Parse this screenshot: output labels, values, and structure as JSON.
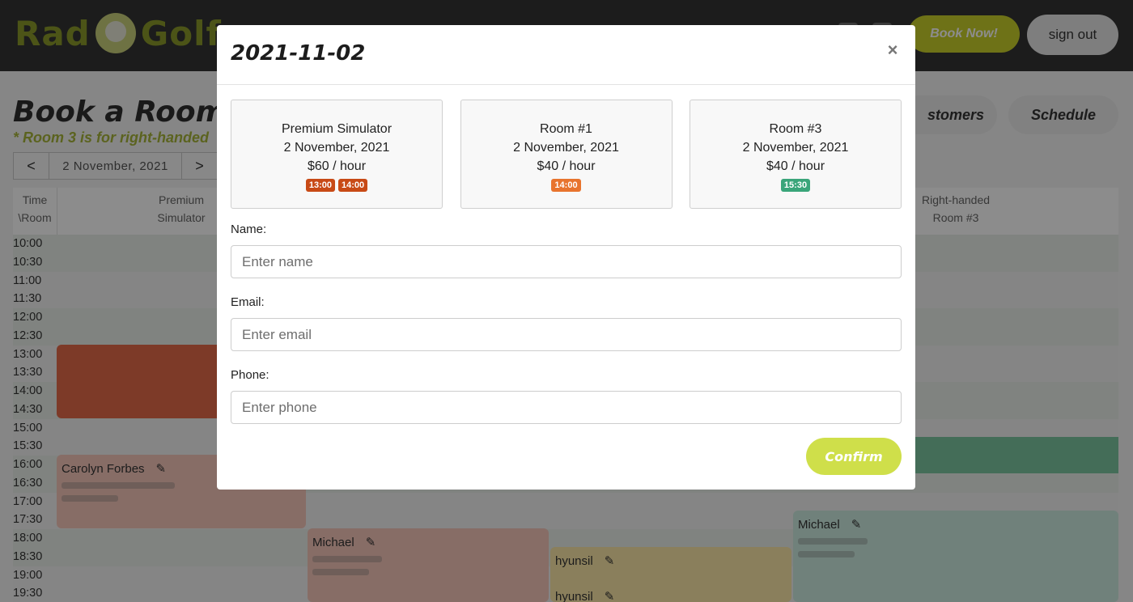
{
  "header": {
    "logo_text_left": "Rad",
    "logo_text_right": "Golf",
    "book_now": "Book Now!",
    "sign_out": "sign out"
  },
  "page": {
    "title": "Book a Room",
    "note": "* Room 3 is for right-handed",
    "date_prev": "<",
    "date": "2 November, 2021",
    "date_next": ">",
    "tab_customers": "stomers",
    "tab_schedule": "Schedule"
  },
  "grid": {
    "time_header": [
      "Time",
      "\\Room"
    ],
    "columns": [
      {
        "line1": "Premium",
        "line2": "Simulator"
      },
      {
        "line1": "Right-handed",
        "line2": "Room #3"
      }
    ],
    "times": [
      "10:00",
      "10:30",
      "11:00",
      "11:30",
      "12:00",
      "12:30",
      "13:00",
      "13:30",
      "14:00",
      "14:30",
      "15:00",
      "15:30",
      "16:00",
      "16:30",
      "17:00",
      "17:30",
      "18:00",
      "18:30",
      "19:00",
      "19:30"
    ],
    "bookings": [
      {
        "name": "Carolyn Forbes"
      },
      {
        "name": "Michael"
      },
      {
        "name": "hyunsil"
      },
      {
        "name": "hyunsil"
      },
      {
        "name": "Michael"
      }
    ]
  },
  "modal": {
    "title": "2021-11-02",
    "close": "×",
    "rooms": [
      {
        "name": "Premium Simulator",
        "date": "2 November, 2021",
        "price": "$60 / hour",
        "slots": [
          {
            "time": "13:00",
            "color": "#c84a16"
          },
          {
            "time": "14:00",
            "color": "#c84a16"
          }
        ]
      },
      {
        "name": "Room #1",
        "date": "2 November, 2021",
        "price": "$40 / hour",
        "slots": [
          {
            "time": "14:00",
            "color": "#e8742e"
          }
        ]
      },
      {
        "name": "Room #3",
        "date": "2 November, 2021",
        "price": "$40 / hour",
        "slots": [
          {
            "time": "15:30",
            "color": "#3aa57a"
          }
        ]
      }
    ],
    "form": {
      "name_label": "Name:",
      "name_placeholder": "Enter name",
      "email_label": "Email:",
      "email_placeholder": "Enter email",
      "phone_label": "Phone:",
      "phone_placeholder": "Enter phone",
      "confirm": "Confirm"
    }
  }
}
